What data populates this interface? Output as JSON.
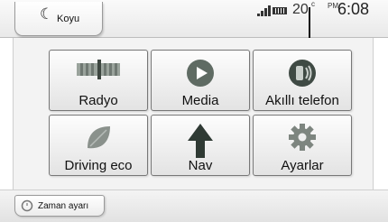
{
  "header": {
    "theme_tab_label": "Koyu",
    "temperature": "20",
    "temperature_unit": "c",
    "am_pm": "PM",
    "time": "6:08"
  },
  "tiles": [
    {
      "label": "Radyo",
      "icon": "radio-icon"
    },
    {
      "label": "Media",
      "icon": "media-play-icon"
    },
    {
      "label": "Akıllı telefon",
      "icon": "smartphone-icon"
    },
    {
      "label": "Driving eco",
      "icon": "eco-leaf-icon"
    },
    {
      "label": "Nav",
      "icon": "nav-arrow-icon"
    },
    {
      "label": "Ayarlar",
      "icon": "settings-gear-icon"
    }
  ],
  "footer": {
    "clock_button_label": "Zaman ayarı"
  },
  "colors": {
    "media_icon": "#5f6b63",
    "phone_icon": "#3f4a44",
    "eco_icon": "#8a918c",
    "nav_icon": "#2f3a34",
    "settings_icon": "#7d857f"
  }
}
